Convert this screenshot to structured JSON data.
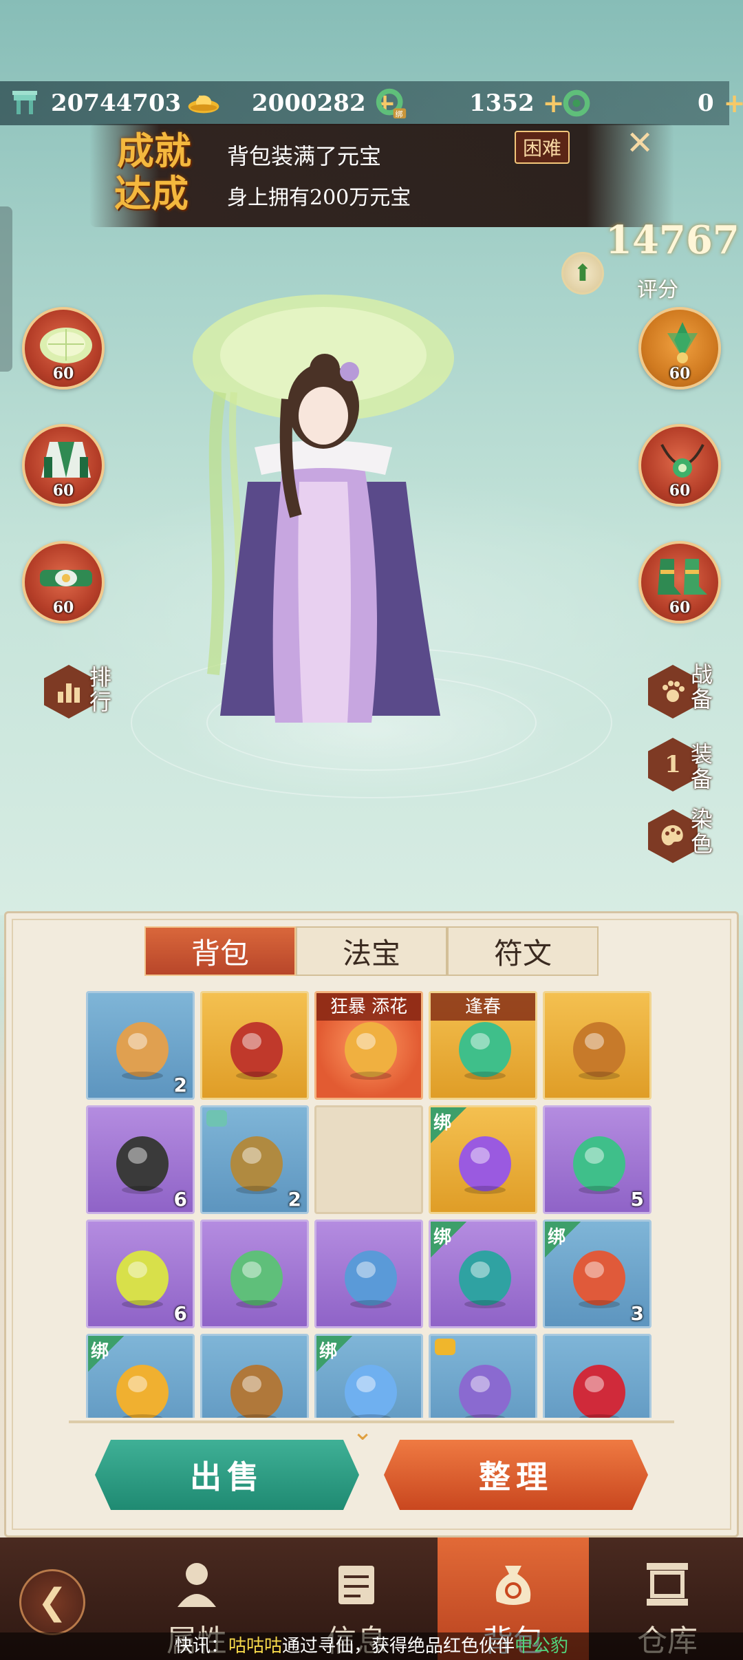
{
  "currencies": [
    {
      "icon": "jade-token-icon",
      "value": "20744703"
    },
    {
      "icon": "gold-ingot-icon",
      "value": "2000282"
    },
    {
      "icon": "bound-jade-ring-icon",
      "value": "1352",
      "badge": "绑"
    },
    {
      "icon": "jade-ring-icon",
      "value": "0"
    }
  ],
  "achievement": {
    "logo": "成就达成",
    "title": "背包装满了元宝",
    "description": "身上拥有200万元宝",
    "difficulty": "困难"
  },
  "score": {
    "value": "14767",
    "label": "评分"
  },
  "equipment_left": [
    {
      "name": "lotus-leaf-hat-slot",
      "level": "60"
    },
    {
      "name": "robe-slot",
      "level": "60"
    },
    {
      "name": "belt-slot",
      "level": "60"
    }
  ],
  "equipment_right": [
    {
      "name": "hairpin-slot",
      "level": "60"
    },
    {
      "name": "necklace-slot",
      "level": "60"
    },
    {
      "name": "boots-slot",
      "level": "60"
    }
  ],
  "side_left": {
    "label": "排行"
  },
  "side_right": [
    {
      "label": "战备",
      "glyph": "🐾"
    },
    {
      "label": "装备",
      "glyph": "1"
    },
    {
      "label": "染色",
      "glyph": "🎨"
    }
  ],
  "tabs": [
    {
      "label": "背包",
      "active": true
    },
    {
      "label": "法宝",
      "active": false
    },
    {
      "label": "符文",
      "active": false
    }
  ],
  "items": [
    {
      "quality": "blue",
      "icon": "card-bundle-icon",
      "count": "2"
    },
    {
      "quality": "gold",
      "icon": "cloak-icon",
      "count": ""
    },
    {
      "quality": "red",
      "icon": "amulet-icon",
      "count": "",
      "banner": "狂暴 添花"
    },
    {
      "quality": "gold",
      "icon": "jade-pendant-icon",
      "count": "",
      "banner": "逢春"
    },
    {
      "quality": "gold",
      "icon": "bracelet-icon",
      "count": ""
    },
    {
      "quality": "purple",
      "icon": "ore-icon",
      "count": "6"
    },
    {
      "quality": "blue",
      "icon": "goblet-icon",
      "count": "2",
      "mark": "jade-token-icon"
    },
    {
      "quality": "empty",
      "icon": "",
      "count": ""
    },
    {
      "quality": "gold",
      "icon": "crystal-icon",
      "count": "",
      "bind": "绑"
    },
    {
      "quality": "purple",
      "icon": "pet-orb-icon",
      "count": "5"
    },
    {
      "quality": "purple",
      "icon": "yellow-gem-icon",
      "count": "6"
    },
    {
      "quality": "purple",
      "icon": "scroll-icon",
      "count": ""
    },
    {
      "quality": "purple",
      "icon": "crystal-ball-icon",
      "count": ""
    },
    {
      "quality": "purple",
      "icon": "fruit-icon",
      "count": "",
      "bind": "绑"
    },
    {
      "quality": "blue",
      "icon": "red-fox-icon",
      "count": "3",
      "bind": "绑"
    },
    {
      "quality": "blue",
      "icon": "golden-fruit-icon",
      "count": "",
      "bind": "绑"
    },
    {
      "quality": "blue",
      "icon": "censer-icon",
      "count": ""
    },
    {
      "quality": "blue",
      "icon": "potion-icon",
      "count": "",
      "bind": "绑"
    },
    {
      "quality": "blue",
      "icon": "book-icon",
      "count": "",
      "mark": "gold-ingot-icon"
    },
    {
      "quality": "blue",
      "icon": "rose-icon",
      "count": ""
    }
  ],
  "buttons": {
    "sell": "出售",
    "sort": "整理"
  },
  "nav": [
    {
      "label": "属性",
      "icon": "profile-icon"
    },
    {
      "label": "信息",
      "icon": "info-scroll-icon"
    },
    {
      "label": "背包",
      "icon": "money-bag-icon",
      "active": true
    },
    {
      "label": "仓库",
      "icon": "warehouse-icon"
    }
  ],
  "ticker": {
    "prefix": "快讯：",
    "player": "咕咕咕",
    "middle": "通过寻仙，获得绝品红色伙伴",
    "partner": "中公豹"
  }
}
